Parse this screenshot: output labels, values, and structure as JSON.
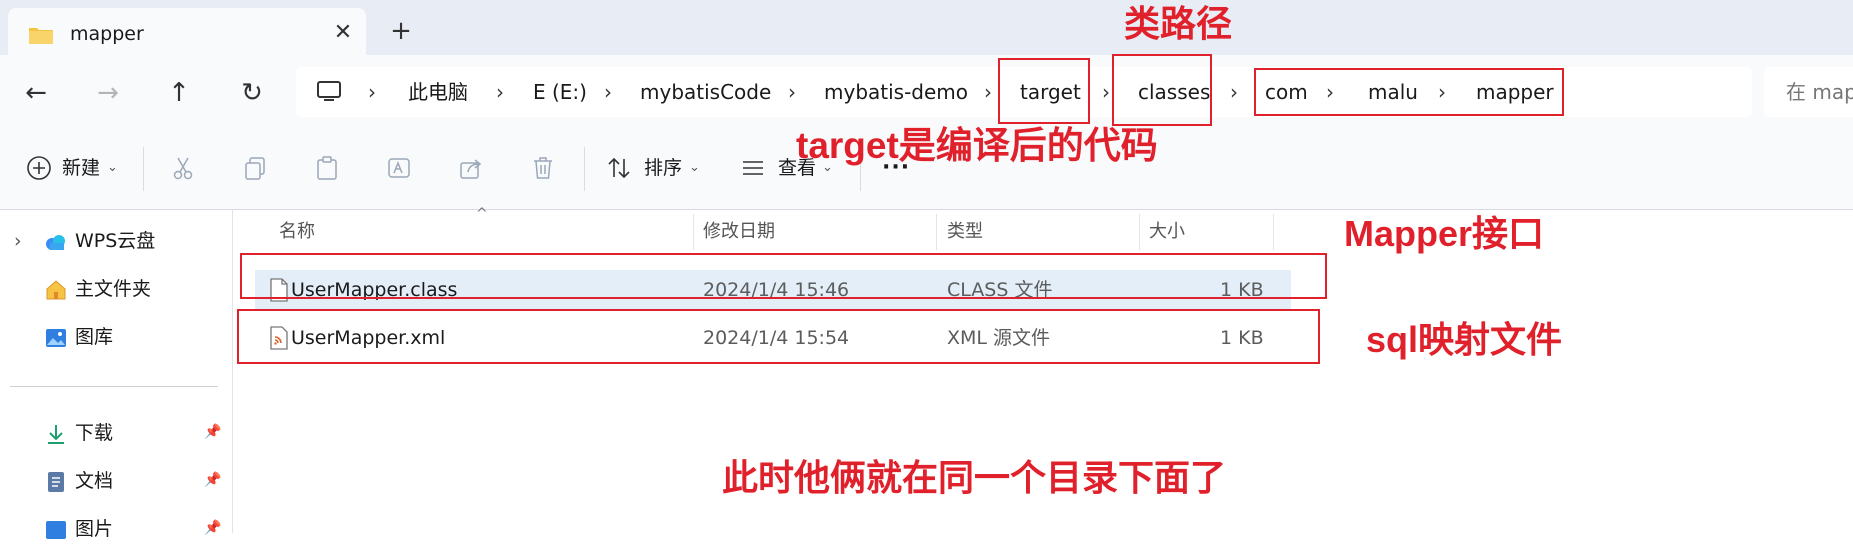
{
  "tab": {
    "title": "mapper",
    "close_glyph": "✕",
    "new_glyph": "+"
  },
  "nav": {
    "back_glyph": "←",
    "forward_glyph": "→",
    "up_glyph": "↑",
    "refresh_glyph": "↻",
    "breadcrumbs": [
      "此电脑",
      "E (E:)",
      "mybatisCode",
      "mybatis-demo",
      "target",
      "classes",
      "com",
      "malu",
      "mapper"
    ],
    "separator": "›",
    "search_placeholder": "在 map"
  },
  "toolbar": {
    "new_label": "新建",
    "sort_label": "排序",
    "view_label": "查看",
    "more_glyph": "···",
    "chevron": "⌄"
  },
  "sidebar": {
    "items": [
      {
        "label": "WPS云盘",
        "icon": "cloud-icon",
        "expand": "›"
      },
      {
        "label": "主文件夹",
        "icon": "home-icon"
      },
      {
        "label": "图库",
        "icon": "gallery-icon"
      },
      {
        "label": "下载",
        "icon": "download-icon"
      },
      {
        "label": "文档",
        "icon": "documents-icon"
      },
      {
        "label": "图片",
        "icon": "pictures-icon"
      }
    ],
    "pin_glyph": "📌"
  },
  "columns": {
    "name": "名称",
    "date": "修改日期",
    "type": "类型",
    "size": "大小",
    "sort_glyph": "^"
  },
  "files": [
    {
      "name": "UserMapper.class",
      "date": "2024/1/4 15:46",
      "type": "CLASS 文件",
      "size": "1 KB",
      "icon": "file-icon"
    },
    {
      "name": "UserMapper.xml",
      "date": "2024/1/4 15:54",
      "type": "XML 源文件",
      "size": "1 KB",
      "icon": "xml-file-icon"
    }
  ],
  "annotations": {
    "classpath": "类路径",
    "target_note": "target是编译后的代码",
    "mapper_interface": "Mapper接口",
    "sql_mapping": "sql映射文件",
    "same_dir": "此时他俩就在同一个目录下面了"
  },
  "colors": {
    "annotation_red": "#e0202a",
    "selection": "#e3eef9",
    "chrome": "#e8ecf4"
  }
}
